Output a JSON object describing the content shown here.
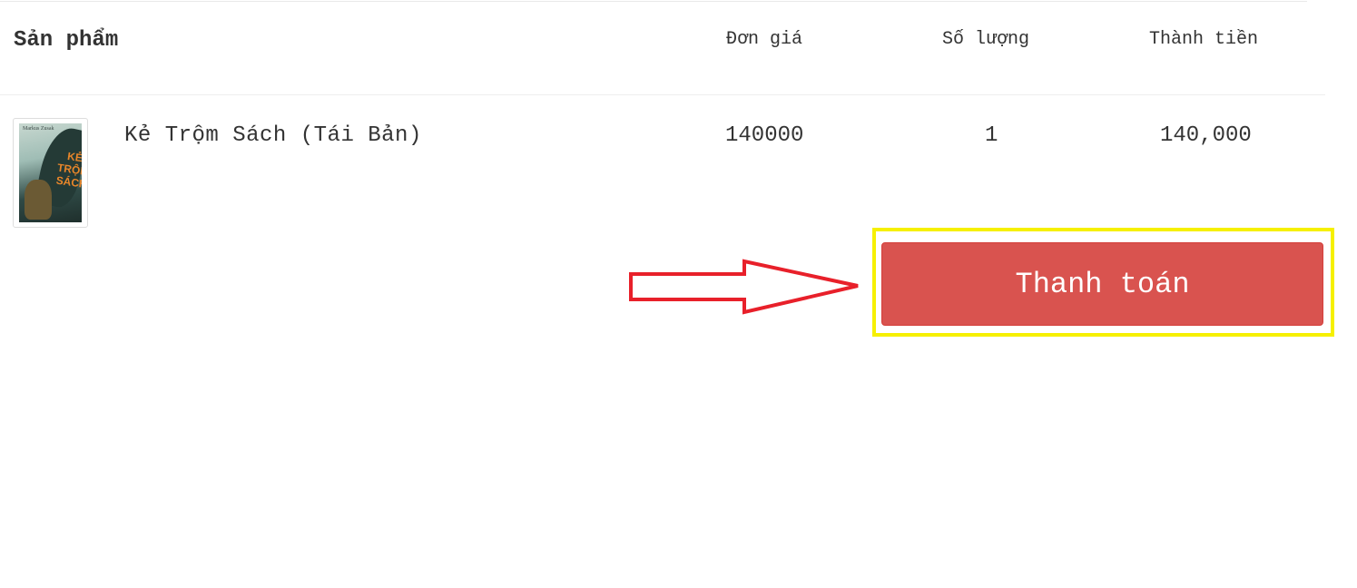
{
  "cart_table": {
    "headers": {
      "product": "Sản phẩm",
      "unit_price": "Đơn giá",
      "quantity": "Số lượng",
      "total": "Thành tiền"
    },
    "rows": [
      {
        "thumbnail": {
          "author": "Markus Zusak",
          "cover_title": "KẺ TRỘM SÁCH"
        },
        "name": "Kẻ Trộm Sách (Tái Bản)",
        "unit_price": "140000",
        "quantity": "1",
        "total": "140,000"
      }
    ]
  },
  "checkout": {
    "button_label": "Thanh toán",
    "button_color": "#d9534f"
  },
  "annotations": {
    "arrow_icon": "right-arrow-icon",
    "arrow_color": "#e8202a",
    "highlight_color": "#f6f000"
  }
}
